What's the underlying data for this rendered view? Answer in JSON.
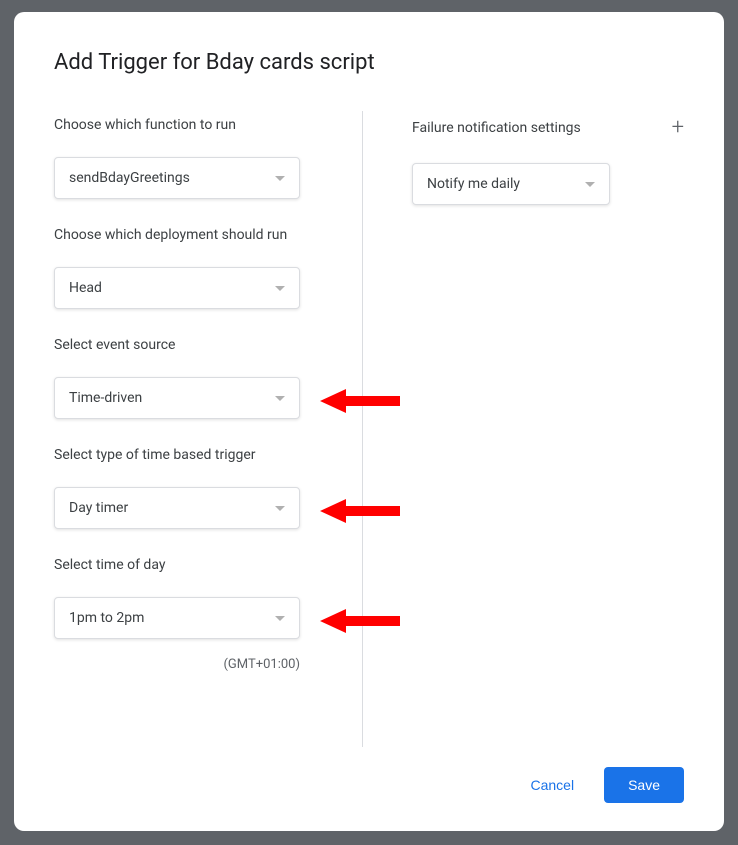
{
  "title": "Add Trigger for Bday cards script",
  "left": {
    "function": {
      "label": "Choose which function to run",
      "value": "sendBdayGreetings"
    },
    "deployment": {
      "label": "Choose which deployment should run",
      "value": "Head"
    },
    "event_source": {
      "label": "Select event source",
      "value": "Time-driven"
    },
    "trigger_type": {
      "label": "Select type of time based trigger",
      "value": "Day timer"
    },
    "time_of_day": {
      "label": "Select time of day",
      "value": "1pm to 2pm"
    },
    "timezone": "(GMT+01:00)"
  },
  "right": {
    "failure_label": "Failure notification settings",
    "failure_value": "Notify me daily"
  },
  "footer": {
    "cancel": "Cancel",
    "save": "Save"
  },
  "annotations": {
    "arrow_color": "#ff0000"
  }
}
